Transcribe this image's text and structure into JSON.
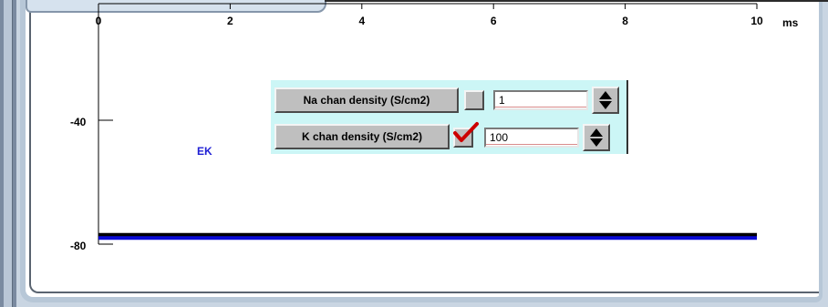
{
  "graph": {
    "x_unit": "ms",
    "ek_label": "EK",
    "colors": {
      "ek_line": "#0a0ad6",
      "voltage_line": "#000000",
      "axis": "#000000"
    }
  },
  "chart_data": {
    "type": "line",
    "xlim": [
      0,
      10
    ],
    "x_ticks": [
      0,
      2,
      4,
      6,
      8,
      10
    ],
    "x_tick_labels": [
      "0",
      "2",
      "4",
      "6",
      "8",
      "10"
    ],
    "x_unit_label": "ms",
    "y_ticks": [
      -40,
      -80
    ],
    "y_tick_labels": [
      "-40",
      "-80"
    ],
    "series": [
      {
        "x": [
          0,
          10
        ],
        "y": [
          -77,
          -77
        ],
        "color": "#000000"
      },
      {
        "name": "EK",
        "x": [
          0,
          10
        ],
        "y": [
          -78,
          -78
        ],
        "color": "#0a0ad6"
      }
    ]
  },
  "controls": {
    "na": {
      "label": "Na chan density (S/cm2)",
      "checked": false,
      "value": "1"
    },
    "k": {
      "label": "K chan density (S/cm2)",
      "checked": true,
      "value": "100"
    }
  }
}
